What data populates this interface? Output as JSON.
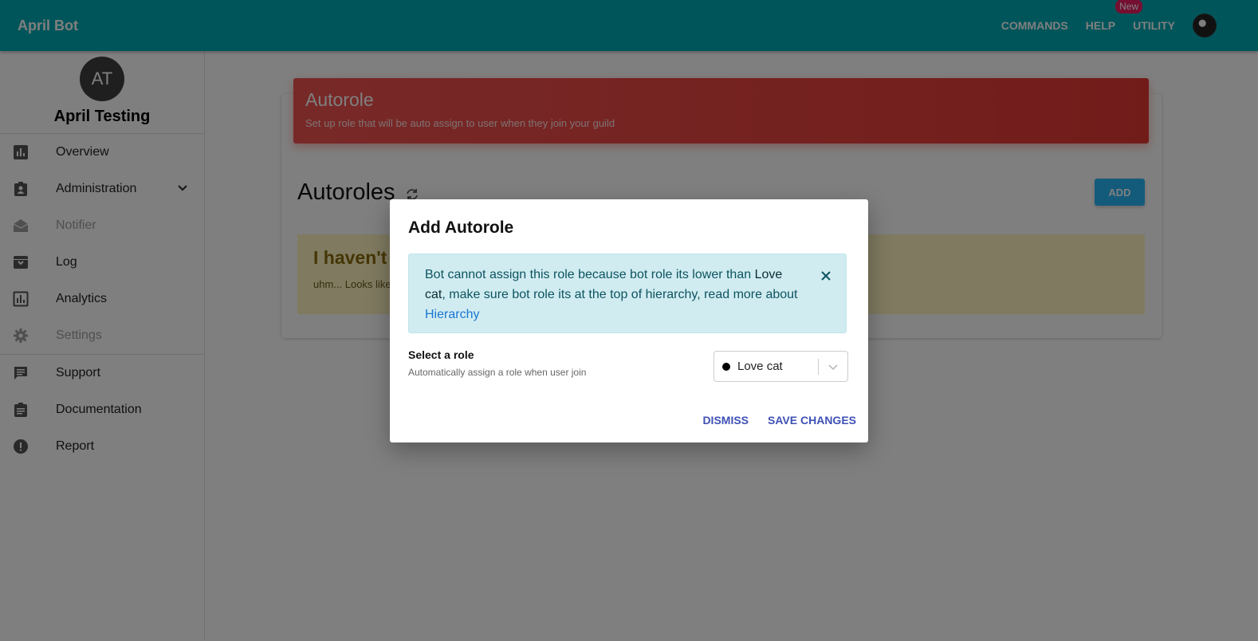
{
  "topbar": {
    "brand": "April Bot",
    "nav": [
      {
        "label": "COMMANDS"
      },
      {
        "label": "HELP"
      },
      {
        "label": "UTILITY",
        "badge": "New"
      }
    ]
  },
  "sidebar": {
    "guild_initials": "AT",
    "guild_name": "April Testing",
    "items": [
      {
        "label": "Overview",
        "icon": "bar-chart-icon",
        "disabled": false
      },
      {
        "label": "Administration",
        "icon": "clipboard-account-icon",
        "disabled": false,
        "expandable": true
      },
      {
        "label": "Notifier",
        "icon": "envelope-open-icon",
        "disabled": true
      },
      {
        "label": "Log",
        "icon": "archive-icon",
        "disabled": false
      },
      {
        "label": "Analytics",
        "icon": "analytics-icon",
        "disabled": false
      },
      {
        "label": "Settings",
        "icon": "gear-icon",
        "disabled": true
      },
      {
        "label": "Support",
        "icon": "chat-icon",
        "disabled": false
      },
      {
        "label": "Documentation",
        "icon": "document-icon",
        "disabled": false
      },
      {
        "label": "Report",
        "icon": "alert-circle-icon",
        "disabled": false
      }
    ]
  },
  "main": {
    "banner_title": "Autorole",
    "banner_subtitle": "Set up role that will be auto assign to user when they join your guild",
    "section_title": "Autoroles",
    "add_label": "ADD",
    "warning_title": "I haven't",
    "warning_text": "uhm... Looks like"
  },
  "modal": {
    "title": "Add Autorole",
    "alert_text_1": "Bot cannot assign this role because bot role its lower than ",
    "alert_role": "Love cat",
    "alert_text_2": ", make sure bot role its at the top of hierarchy, read more about ",
    "alert_link": "Hierarchy",
    "select_label": "Select a role",
    "select_hint": "Automatically assign a role when user join",
    "selected_role": "Love cat",
    "dismiss_label": "DISMISS",
    "save_label": "SAVE CHANGES"
  },
  "colors": {
    "topbar": "#00aab5",
    "banner": "#e53935",
    "add_button": "#29b6f6",
    "alert_bg": "#d1ecf1",
    "action_text": "#3f51b5",
    "badge": "#e91e63"
  }
}
